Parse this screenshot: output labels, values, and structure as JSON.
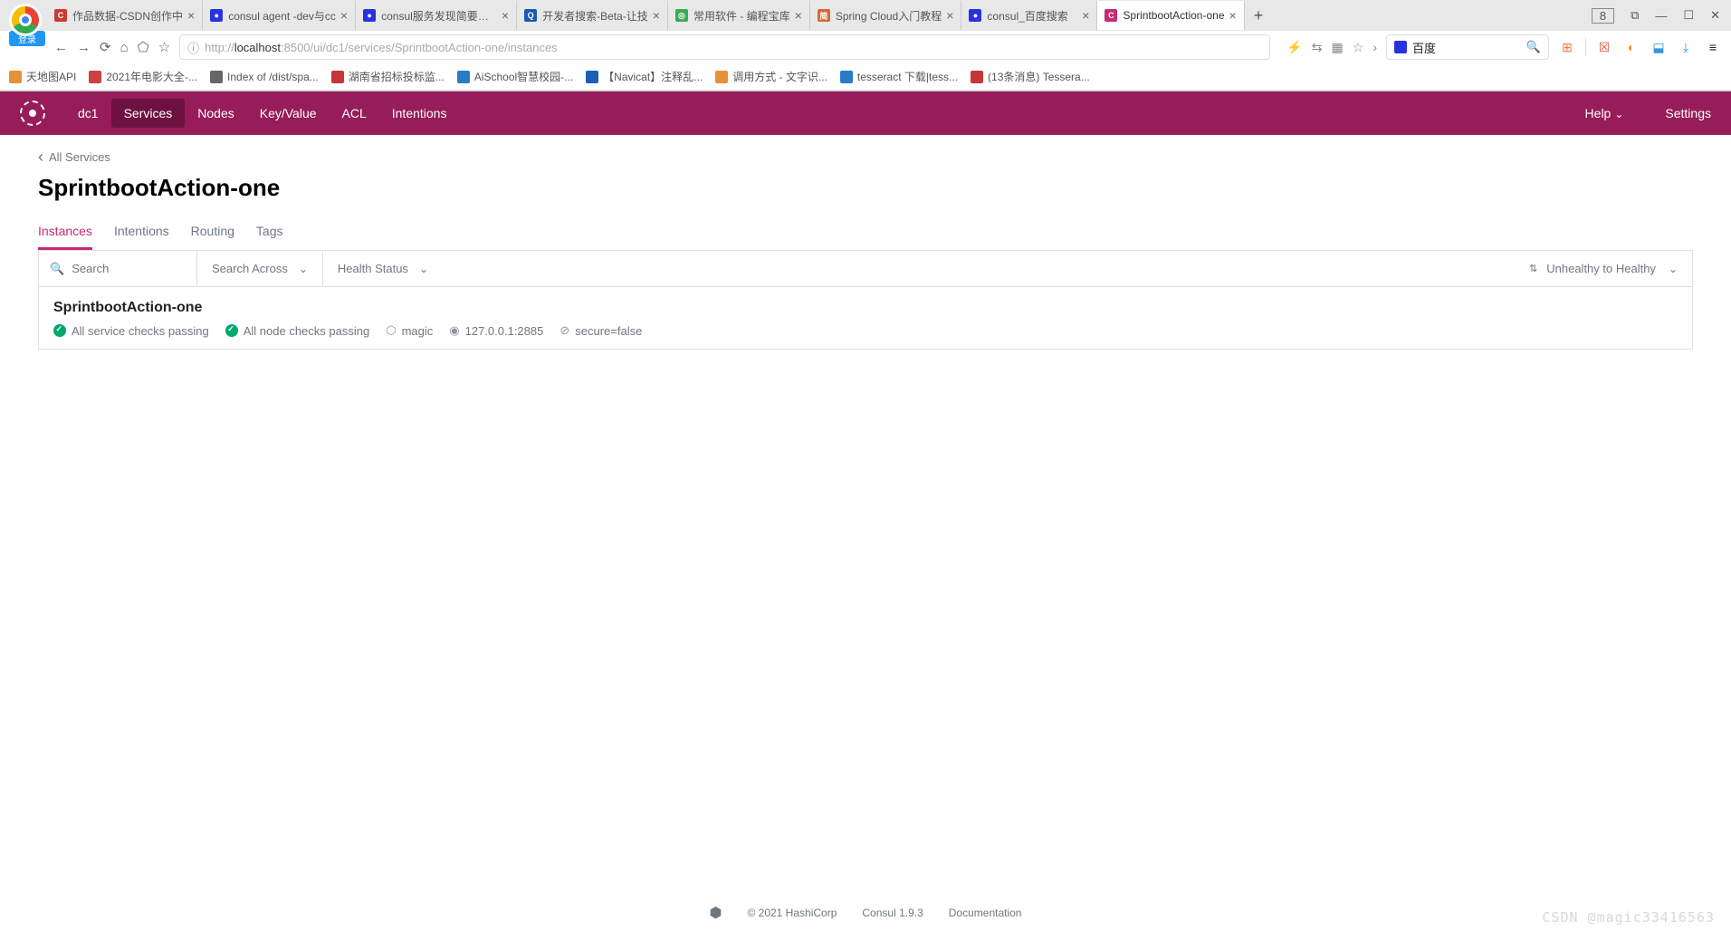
{
  "browser": {
    "login_label": "登录",
    "tab_count": "8",
    "tabs": [
      {
        "title": "作品数据-CSDN创作中",
        "fav": "#c83c32",
        "letter": "C"
      },
      {
        "title": "consul agent -dev与cc",
        "fav": "#2932e1",
        "letter": "●"
      },
      {
        "title": "consul服务发现简要介绍",
        "fav": "#2932e1",
        "letter": "●"
      },
      {
        "title": "开发者搜索-Beta-让技",
        "fav": "#1e59b0",
        "letter": "Q"
      },
      {
        "title": "常用软件 - 编程宝库",
        "fav": "#3aaa56",
        "letter": "◎"
      },
      {
        "title": "Spring Cloud入门教程",
        "fav": "#d86a3a",
        "letter": "简"
      },
      {
        "title": "consul_百度搜索",
        "fav": "#2932e1",
        "letter": "●"
      },
      {
        "title": "SprintbootAction-one",
        "fav": "#c62a71",
        "letter": "C",
        "active": true
      }
    ],
    "url": {
      "pre": "http://",
      "host": "localhost",
      "rest": ":8500/ui/dc1/services/SprintbootAction-one/instances"
    },
    "search_engine": "百度",
    "bookmarks": [
      {
        "label": "天地图API",
        "color": "#e69138"
      },
      {
        "label": "2021年电影大全-...",
        "color": "#cc4242"
      },
      {
        "label": "Index of /dist/spa...",
        "color": "#666"
      },
      {
        "label": "湖南省招标投标监...",
        "color": "#c53737"
      },
      {
        "label": "AiSchool智慧校园-...",
        "color": "#2a7cc7"
      },
      {
        "label": "【Navicat】注释乱...",
        "color": "#1a5fb4"
      },
      {
        "label": "调用方式 - 文字识...",
        "color": "#e69138"
      },
      {
        "label": "tesseract 下载|tess...",
        "color": "#2a7cc7"
      },
      {
        "label": "(13条消息) Tessera...",
        "color": "#c53737"
      }
    ]
  },
  "header": {
    "dc": "dc1",
    "nav": [
      "Services",
      "Nodes",
      "Key/Value",
      "ACL",
      "Intentions"
    ],
    "active_nav": "Services",
    "help": "Help",
    "settings": "Settings"
  },
  "page": {
    "breadcrumb": "All Services",
    "title": "SprintbootAction-one",
    "tabs": [
      "Instances",
      "Intentions",
      "Routing",
      "Tags"
    ],
    "active_tab": "Instances",
    "search_placeholder": "Search",
    "search_across": "Search Across",
    "health_status": "Health Status",
    "sort_label": "Unhealthy to Healthy"
  },
  "instance": {
    "name": "SprintbootAction-one",
    "service_checks": "All service checks passing",
    "node_checks": "All node checks passing",
    "node": "magic",
    "address": "127.0.0.1:2885",
    "tag": "secure=false"
  },
  "footer": {
    "copyright": "© 2021 HashiCorp",
    "version": "Consul 1.9.3",
    "docs": "Documentation"
  },
  "watermark": "CSDN @magic33416563"
}
